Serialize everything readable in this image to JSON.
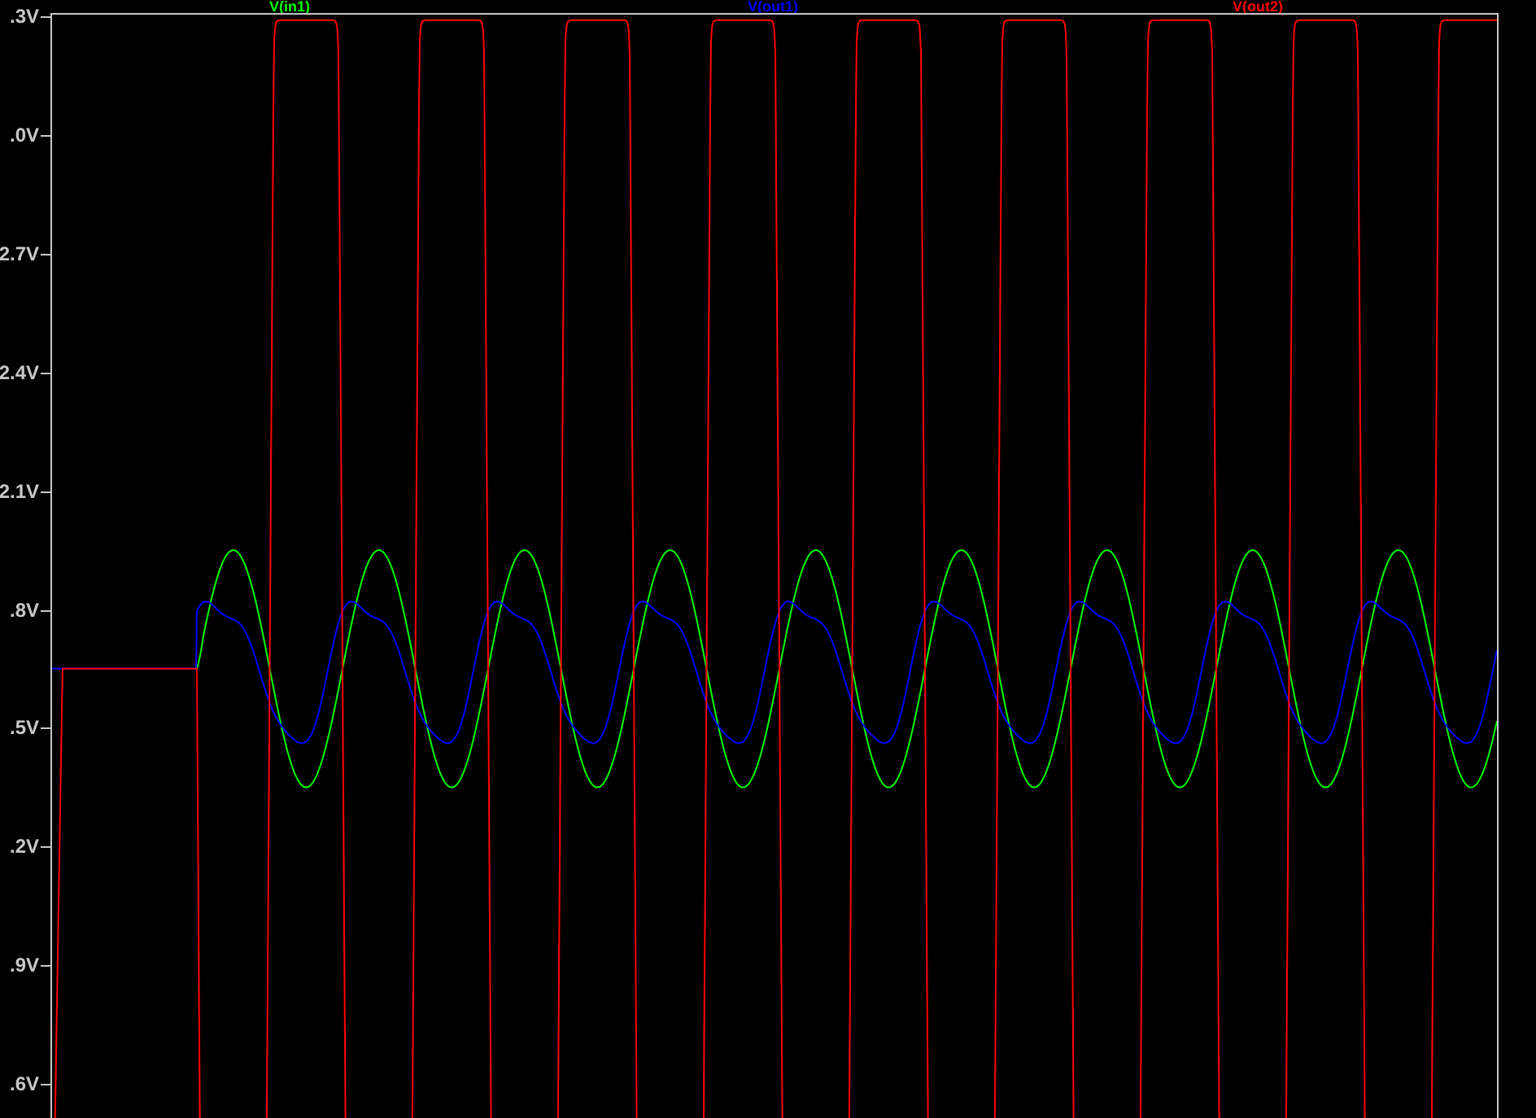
{
  "plot": {
    "traces": [
      {
        "label": "V(in1)",
        "color": "#00ff00",
        "kind": "sine"
      },
      {
        "label": "V(out1)",
        "color": "#0000ff",
        "kind": "distorted"
      },
      {
        "label": "V(out2)",
        "color": "#ff0000",
        "kind": "clipped"
      }
    ],
    "y_ticks": [
      ".3V",
      ".0V",
      "2.7V",
      "2.4V",
      "2.1V",
      ".8V",
      ".5V",
      ".2V",
      ".9V",
      ".6V"
    ]
  }
}
